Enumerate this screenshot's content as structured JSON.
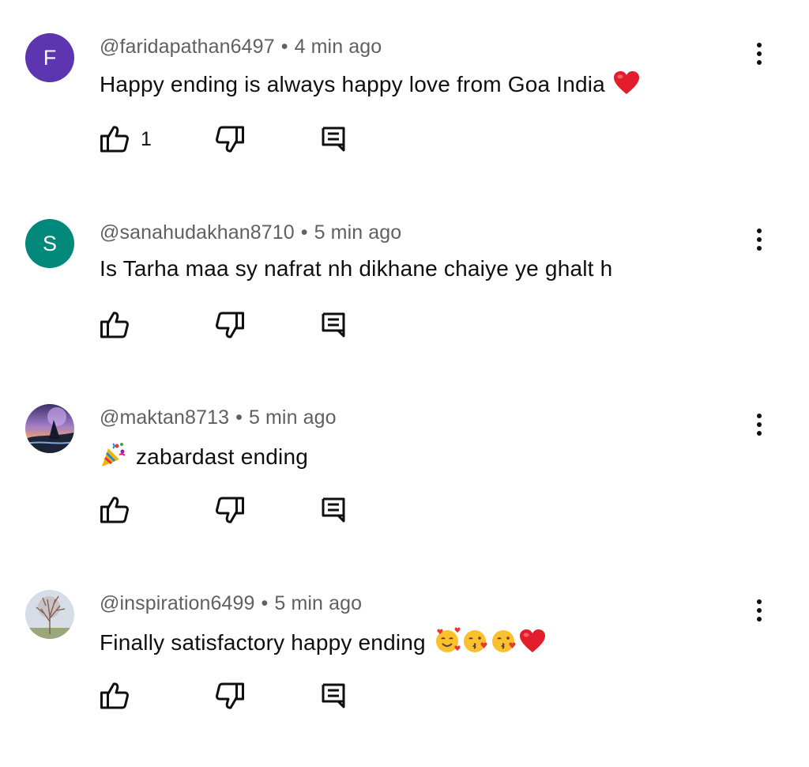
{
  "comments": [
    {
      "author": "@faridapathan6497",
      "time": "4 min ago",
      "text": "Happy ending is always happy love from Goa India",
      "emojis": [
        "heart"
      ],
      "likes": "1",
      "avatar": {
        "letter": "F",
        "color": "#5e35b1"
      }
    },
    {
      "author": "@sanahudakhan8710",
      "time": "5 min ago",
      "text": "Is Tarha maa sy nafrat nh dikhane chaiye ye ghalt h",
      "emojis": [],
      "likes": "",
      "avatar": {
        "letter": "S",
        "color": "#00897b"
      }
    },
    {
      "author": "@maktan8713",
      "time": "5 min ago",
      "text": "zabardast ending",
      "emojis_before": [
        "party-popper"
      ],
      "emojis": [],
      "likes": "",
      "avatar": {
        "letter": "",
        "color": "#4a5a8a"
      }
    },
    {
      "author": "@inspiration6499",
      "time": "5 min ago",
      "text": "Finally satisfactory happy ending",
      "emojis": [
        "smiling-face-with-hearts",
        "face-blowing-kiss",
        "face-blowing-kiss",
        "heart"
      ],
      "likes": "",
      "avatar": {
        "letter": "",
        "color": "#c9d4de"
      }
    }
  ],
  "separator": "•"
}
